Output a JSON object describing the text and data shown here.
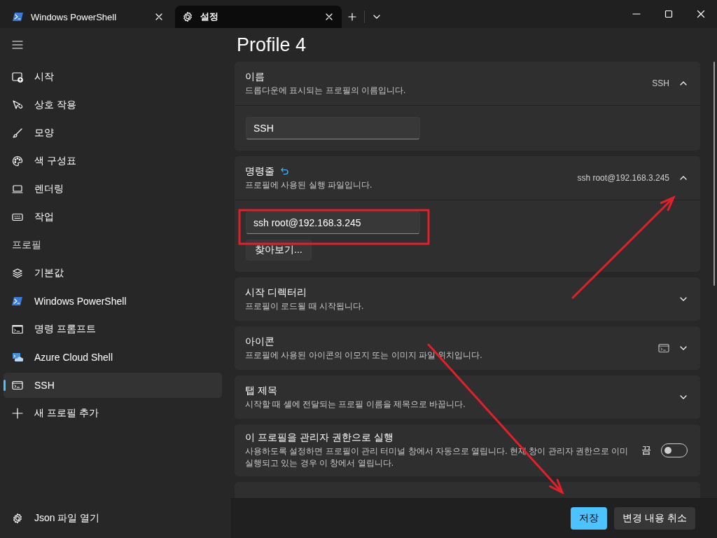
{
  "tabs": [
    {
      "label": "Windows PowerShell",
      "selected": false
    },
    {
      "label": "설정",
      "selected": true
    }
  ],
  "sidebar": {
    "items": [
      {
        "label": "시작",
        "selected": false
      },
      {
        "label": "상호 작용",
        "selected": false
      },
      {
        "label": "모양",
        "selected": false
      },
      {
        "label": "색 구성표",
        "selected": false
      },
      {
        "label": "렌더링",
        "selected": false
      },
      {
        "label": "작업",
        "selected": false
      }
    ],
    "profiles_header": "프로필",
    "profiles": [
      {
        "label": "기본값",
        "selected": false
      },
      {
        "label": "Windows PowerShell",
        "selected": false
      },
      {
        "label": "명령 프롬프트",
        "selected": false
      },
      {
        "label": "Azure Cloud Shell",
        "selected": false
      },
      {
        "label": "SSH",
        "selected": true
      }
    ],
    "add_item": "새 프로필 추가",
    "footer_item": "Json 파일 열기"
  },
  "page_title": "Profile 4",
  "settings": [
    {
      "kind": "expander",
      "title": "이름",
      "description": "드롭다운에 표시되는 프로필의 이름입니다.",
      "summary": "SSH",
      "expanded": true,
      "field_value": "SSH"
    },
    {
      "kind": "expander",
      "title": "명령줄",
      "reset": true,
      "description": "프로필에 사용된 실행 파일입니다.",
      "summary": "ssh root@192.168.3.245",
      "expanded": true,
      "field_value": "ssh root@192.168.3.245",
      "button": "찾아보기..."
    },
    {
      "kind": "expander",
      "title": "시작 디렉터리",
      "description": "프로필이 로드될 때 시작됩니다.",
      "expanded": false
    },
    {
      "kind": "expander",
      "title": "아이콘",
      "description": "프로필에 사용된 아이콘의 이모지 또는 이미지 파일 위치입니다.",
      "summary_icon": true,
      "expanded": false
    },
    {
      "kind": "expander",
      "title": "탭 제목",
      "description": "시작할 때 셸에 전달되는 프로필 이름을 제목으로 바꿉니다.",
      "expanded": false
    },
    {
      "kind": "toggle",
      "title": "이 프로필을 관리자 권한으로 실행",
      "description": "사용하도록 설정하면 프로필이 관리 터미널 창에서 자동으로 열립니다. 현재 창이 관리자 권한으로 이미 실행되고 있는 경우 이 창에서 열립니다.",
      "state_label": "끔",
      "on": false
    },
    {
      "kind": "partial"
    }
  ],
  "footer_buttons": [
    {
      "label": "저장",
      "kind": "primary"
    },
    {
      "label": "변경 내용 취소",
      "kind": "secondary"
    }
  ],
  "annotations": [
    {
      "kind": "frame"
    },
    {
      "kind": "arrow"
    },
    {
      "kind": "arrow"
    }
  ]
}
